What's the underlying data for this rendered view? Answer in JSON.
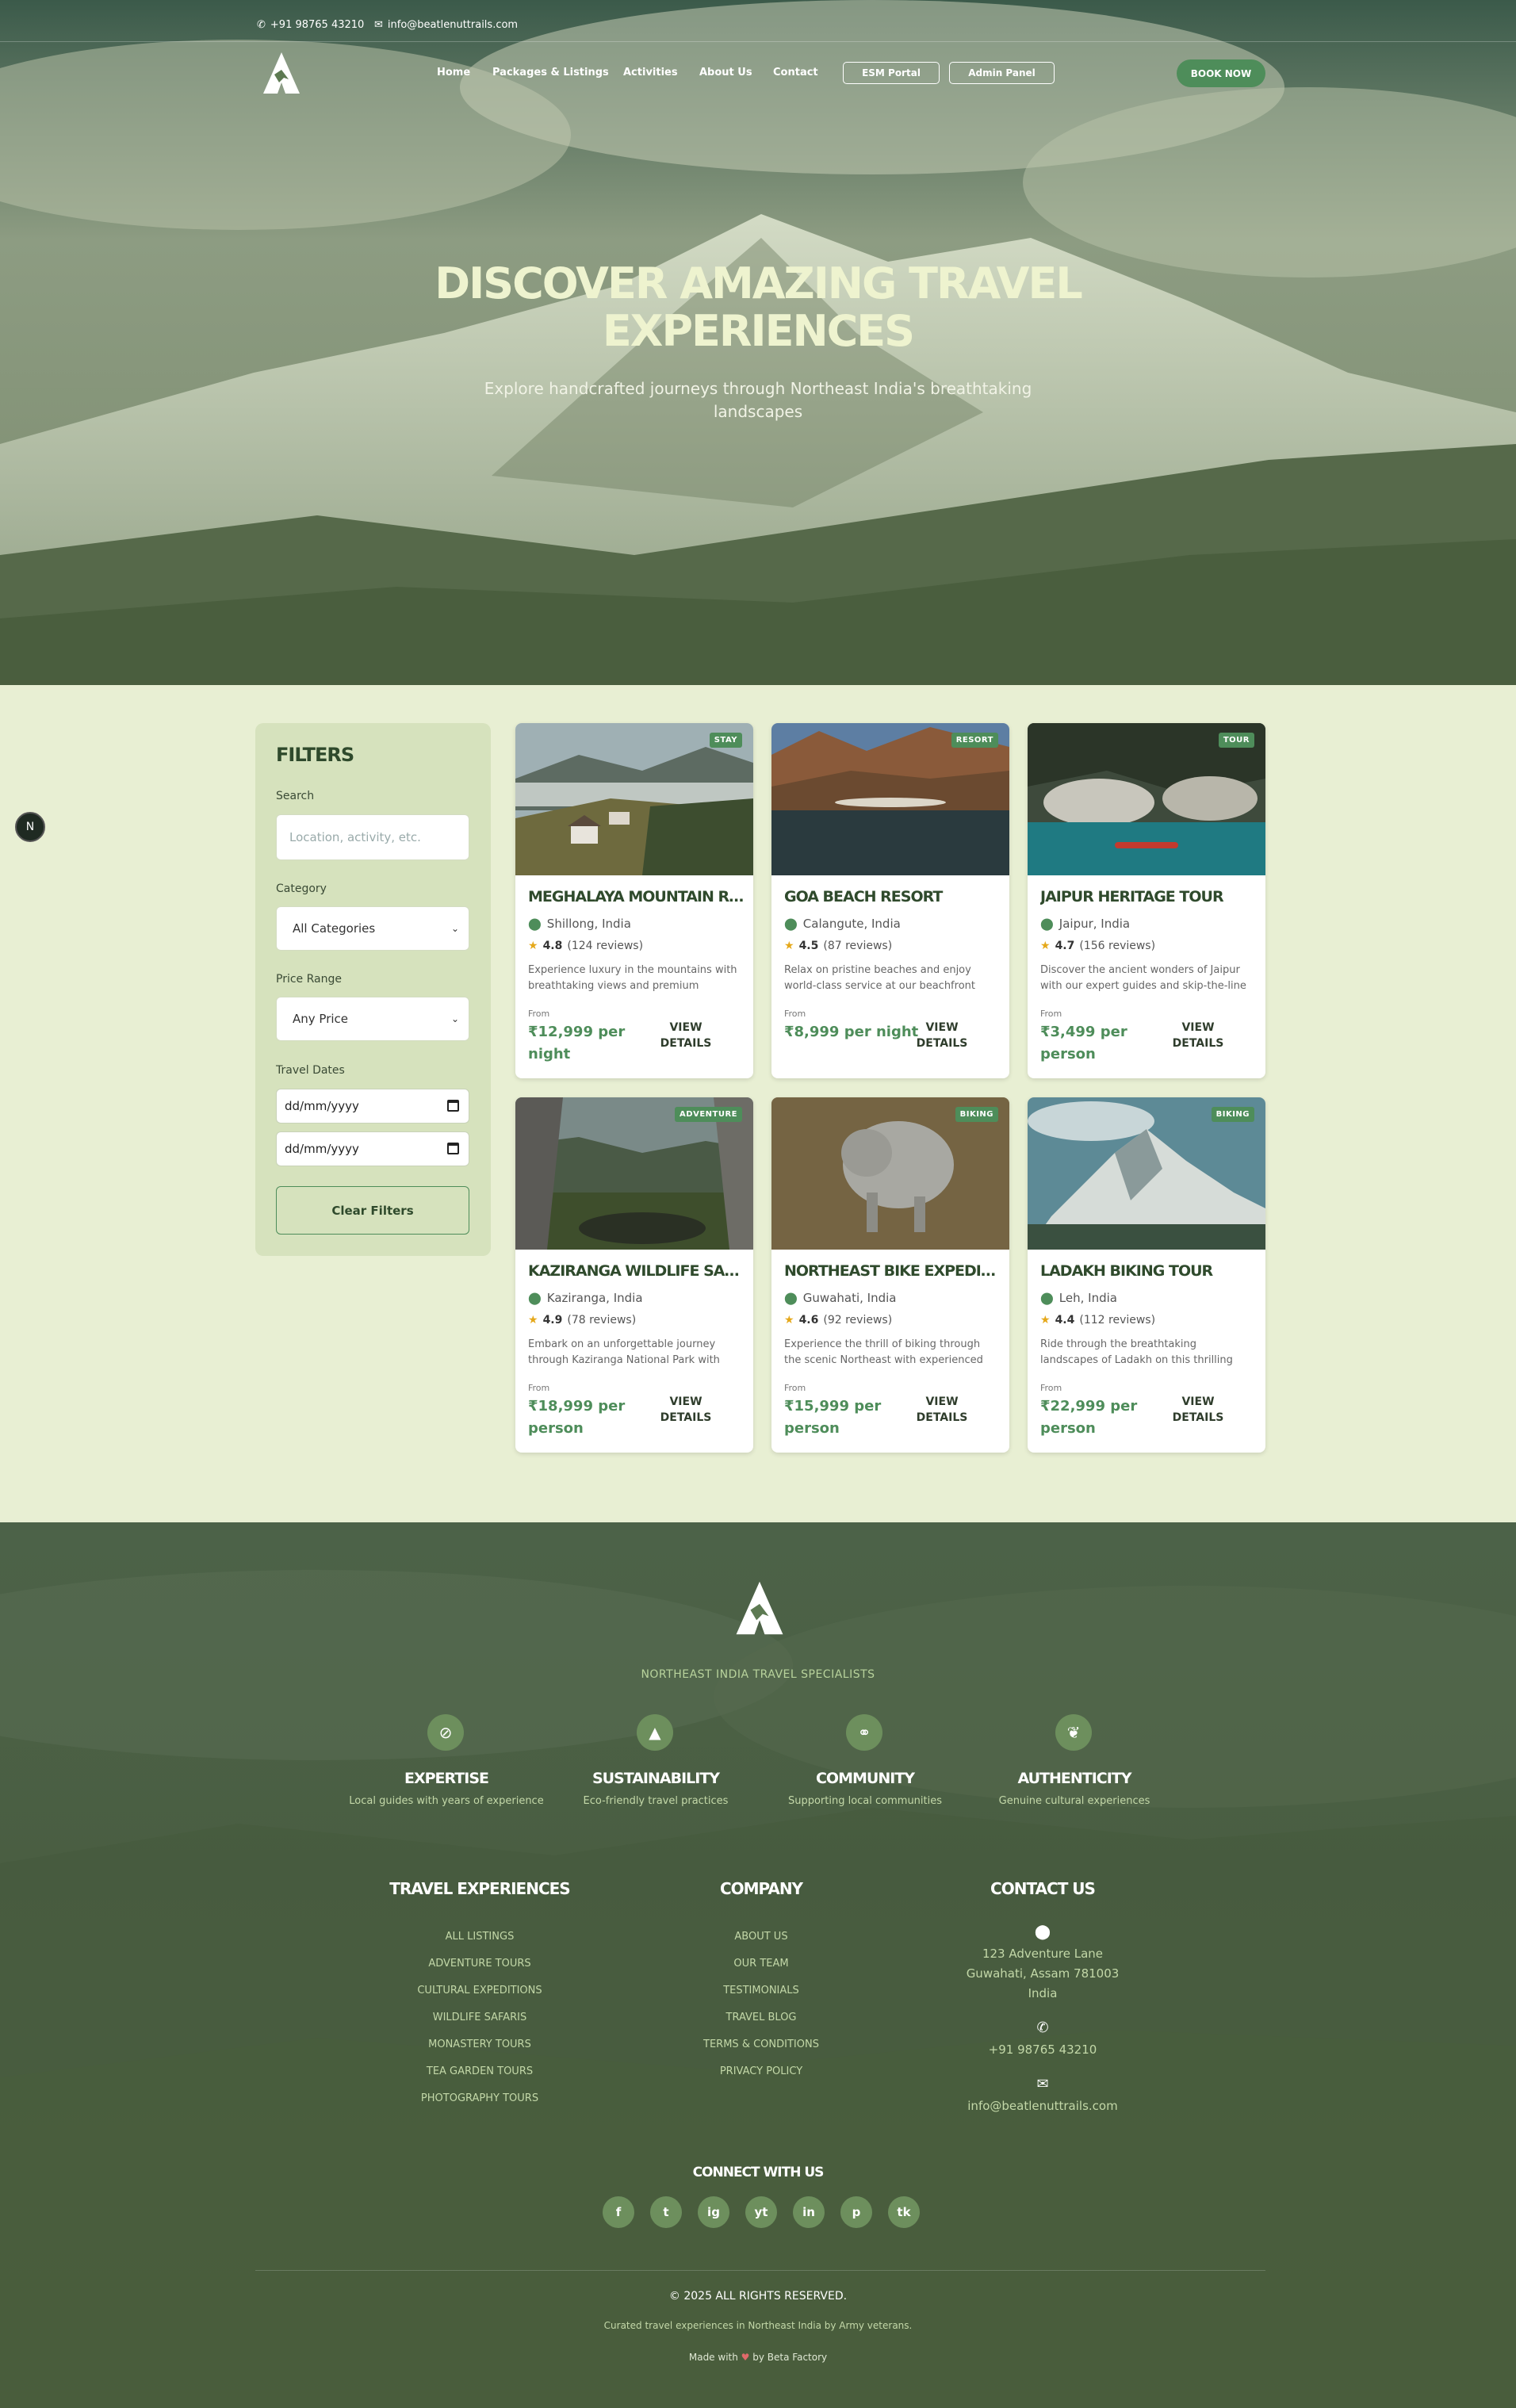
{
  "topbar": {
    "phone": "+91 98765 43210",
    "email": "info@beatlenuttrails.com"
  },
  "nav": {
    "links": [
      "Home",
      "Packages & Listings",
      "Activities",
      "About Us",
      "Contact"
    ],
    "esm_portal": "ESM Portal",
    "admin_panel": "Admin Panel",
    "book_now": "BOOK NOW"
  },
  "hero": {
    "title_line1": "DISCOVER AMAZING TRAVEL",
    "title_line2": "EXPERIENCES",
    "subtitle": "Explore handcrafted journeys through Northeast India's breathtaking landscapes"
  },
  "side_badge": "N",
  "filters": {
    "title": "FILTERS",
    "search_label": "Search",
    "search_placeholder": "Location, activity, etc.",
    "category_label": "Category",
    "category_value": "All Categories",
    "price_label": "Price Range",
    "price_value": "Any Price",
    "dates_label": "Travel Dates",
    "date_from": "dd/mm/yyyy",
    "date_to": "dd/mm/yyyy",
    "clear": "Clear Filters"
  },
  "listings": [
    {
      "badge": "STAY",
      "title": "MEGHALAYA MOUNTAIN RETREAT",
      "location": "Shillong, India",
      "rating": "4.8",
      "reviews": "(124 reviews)",
      "desc": "Experience luxury in the mountains with breathtaking views and premium amenities.",
      "from": "From",
      "price": "₹12,999 per night",
      "view": "VIEW DETAILS"
    },
    {
      "badge": "RESORT",
      "title": "GOA BEACH RESORT",
      "location": "Calangute, India",
      "rating": "4.5",
      "reviews": "(87 reviews)",
      "desc": "Relax on pristine beaches and enjoy world-class service at our beachfront resort.",
      "from": "From",
      "price": "₹8,999 per night",
      "view": "VIEW DETAILS"
    },
    {
      "badge": "TOUR",
      "title": "JAIPUR HERITAGE TOUR",
      "location": "Jaipur, India",
      "rating": "4.7",
      "reviews": "(156 reviews)",
      "desc": "Discover the ancient wonders of Jaipur with our expert guides and skip-the-line access.",
      "from": "From",
      "price": "₹3,499 per person",
      "view": "VIEW DETAILS"
    },
    {
      "badge": "ADVENTURE",
      "title": "KAZIRANGA WILDLIFE SAFARI",
      "location": "Kaziranga, India",
      "rating": "4.9",
      "reviews": "(78 reviews)",
      "desc": "Embark on an unforgettable journey through Kaziranga National Park with expert guides.",
      "from": "From",
      "price": "₹18,999 per person",
      "view": "VIEW DETAILS"
    },
    {
      "badge": "BIKING",
      "title": "NORTHEAST BIKE EXPEDITION",
      "location": "Guwahati, India",
      "rating": "4.6",
      "reviews": "(92 reviews)",
      "desc": "Experience the thrill of biking through the scenic Northeast with experienced riders.",
      "from": "From",
      "price": "₹15,999 per person",
      "view": "VIEW DETAILS"
    },
    {
      "badge": "BIKING",
      "title": "LADAKH BIKING TOUR",
      "location": "Leh, India",
      "rating": "4.4",
      "reviews": "(112 reviews)",
      "desc": "Ride through the breathtaking landscapes of Ladakh on this thrilling adventure.",
      "from": "From",
      "price": "₹22,999 per person",
      "view": "VIEW DETAILS"
    }
  ],
  "footer": {
    "tagline": "NORTHEAST INDIA TRAVEL SPECIALISTS",
    "values": [
      {
        "title": "EXPERTISE",
        "text": "Local guides with years of experience",
        "icon": "compass-icon"
      },
      {
        "title": "SUSTAINABILITY",
        "text": "Eco-friendly travel practices",
        "icon": "tree-icon"
      },
      {
        "title": "COMMUNITY",
        "text": "Supporting local communities",
        "icon": "handshake-icon"
      },
      {
        "title": "AUTHENTICITY",
        "text": "Genuine cultural experiences",
        "icon": "leaf-icon"
      }
    ],
    "travel_title": "TRAVEL EXPERIENCES",
    "travel_links": [
      "ALL LISTINGS",
      "ADVENTURE TOURS",
      "CULTURAL EXPEDITIONS",
      "WILDLIFE SAFARIS",
      "MONASTERY TOURS",
      "TEA GARDEN TOURS",
      "PHOTOGRAPHY TOURS"
    ],
    "company_title": "COMPANY",
    "company_links": [
      "ABOUT US",
      "OUR TEAM",
      "TESTIMONIALS",
      "TRAVEL BLOG",
      "TERMS & CONDITIONS",
      "PRIVACY POLICY"
    ],
    "contact_title": "CONTACT US",
    "address": "123 Adventure Lane Guwahati, Assam 781003 India",
    "phone": "+91 98765 43210",
    "email": "info@beatlenuttrails.com",
    "connect_title": "CONNECT WITH US",
    "social": [
      "f",
      "t",
      "ig",
      "yt",
      "in",
      "p",
      "tk"
    ],
    "copyright": "© 2025 ALL RIGHTS RESERVED.",
    "curated": "Curated travel experiences in Northeast India by Army veterans.",
    "made_with": "Made with",
    "made_by": "by Beta Factory"
  },
  "colors": {
    "accent": "#4e8d5a",
    "page_bg": "#e8efd3",
    "footer_bg": "#4b5f44"
  }
}
